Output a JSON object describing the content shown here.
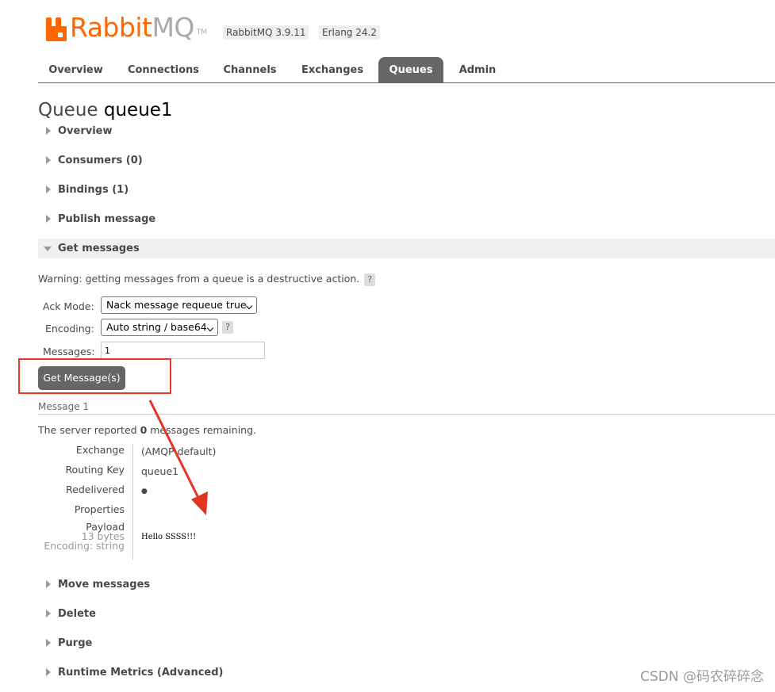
{
  "header": {
    "logo_main": "Rabbit",
    "logo_suffix": "MQ",
    "logo_tm": "TM",
    "rabbitmq_version": "RabbitMQ 3.9.11",
    "erlang_version": "Erlang 24.2"
  },
  "tabs": [
    {
      "label": "Overview",
      "active": false
    },
    {
      "label": "Connections",
      "active": false
    },
    {
      "label": "Channels",
      "active": false
    },
    {
      "label": "Exchanges",
      "active": false
    },
    {
      "label": "Queues",
      "active": true
    },
    {
      "label": "Admin",
      "active": false
    }
  ],
  "page": {
    "title_prefix": "Queue",
    "queue_name": "queue1"
  },
  "sections_top": [
    {
      "label": "Overview"
    },
    {
      "label": "Consumers (0)"
    },
    {
      "label": "Bindings (1)"
    },
    {
      "label": "Publish message"
    }
  ],
  "get_messages": {
    "label": "Get messages",
    "warning": "Warning: getting messages from a queue is a destructive action.",
    "help": "?",
    "ack_mode_label": "Ack Mode:",
    "ack_mode_value": "Nack message requeue true",
    "encoding_label": "Encoding:",
    "encoding_value": "Auto string / base64",
    "messages_label": "Messages:",
    "messages_value": "1",
    "button": "Get Message(s)"
  },
  "result": {
    "message_heading": "Message 1",
    "server_prefix": "The server reported",
    "remaining_count": "0",
    "server_suffix": "messages remaining.",
    "fields": {
      "exchange_label": "Exchange",
      "exchange_value": "(AMQP default)",
      "routing_key_label": "Routing Key",
      "routing_key_value": "queue1",
      "redelivered_label": "Redelivered",
      "redelivered_value": "●",
      "properties_label": "Properties",
      "payload_label": "Payload",
      "payload_size": "13 bytes",
      "payload_encoding": "Encoding: string",
      "payload_value": "Hello SSSS!!!"
    }
  },
  "sections_bottom": [
    {
      "label": "Move messages"
    },
    {
      "label": "Delete"
    },
    {
      "label": "Purge"
    },
    {
      "label": "Runtime Metrics (Advanced)"
    }
  ],
  "watermark": "CSDN @码农碎碎念",
  "colors": {
    "brand": "#ff6600",
    "tab_active": "#666666",
    "annotation_red": "#e33322"
  }
}
